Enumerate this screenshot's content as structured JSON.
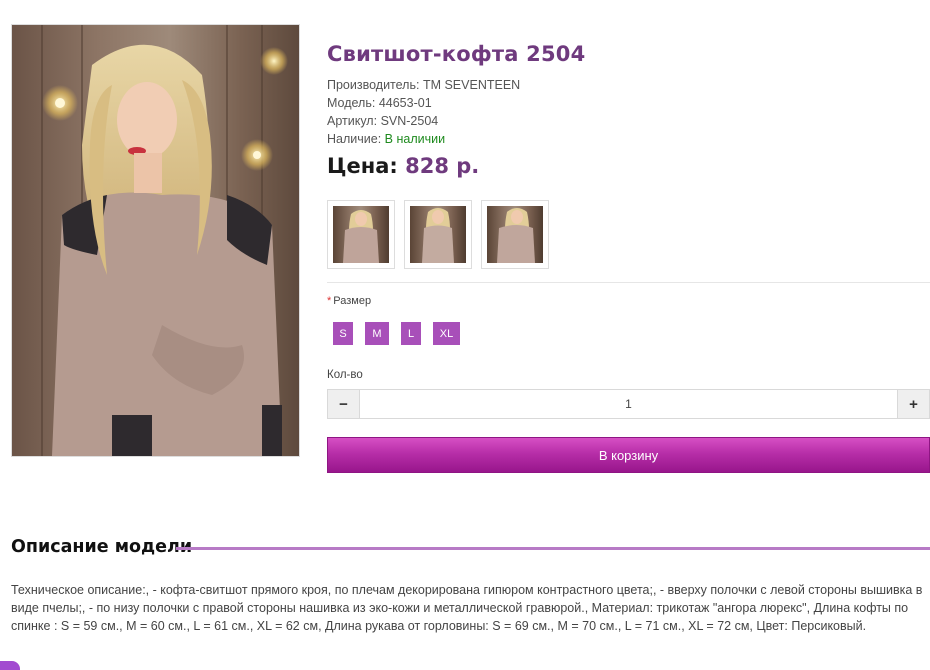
{
  "product": {
    "title": "Свитшот-кофта 2504",
    "manufacturer_label": "Производитель:",
    "manufacturer": "TM SEVENTEEN",
    "model_label": "Модель:",
    "model": "44653-01",
    "sku_label": "Артикул:",
    "sku": "SVN-2504",
    "availability_label": "Наличие:",
    "availability": "В наличии",
    "price_label": "Цена:",
    "price": "828 р."
  },
  "options": {
    "size_label": "Размер",
    "required_mark": "*",
    "sizes": [
      "S",
      "M",
      "L",
      "XL"
    ]
  },
  "quantity": {
    "label": "Кол-во",
    "value": "1",
    "minus": "−",
    "plus": "+"
  },
  "cart": {
    "button_label": "В корзину"
  },
  "description": {
    "heading": "Описание модели",
    "text": "Техническое описание:, - кофта-свитшот прямого кроя, по плечам декорирована гипюром контрастного цвета;, - вверху полочки с левой стороны вышивка в виде пчелы;, - по низу полочки с правой стороны нашивка из эко-кожи и металлической гравюрой., Материал: трикотаж \"ангора люрекс\", Длина кофты по спинке : S = 59 см., M = 60 см., L = 61 см., XL = 62 см, Длина рукава от горловины: S = 69 см., M = 70 см., L = 71 см., XL = 72 см, Цвет: Персиковый."
  },
  "colors": {
    "accent": "#6f3a7e",
    "size_button": "#a84fb9",
    "cart_button": "#b72ea8",
    "in_stock": "#1e8a1e"
  }
}
